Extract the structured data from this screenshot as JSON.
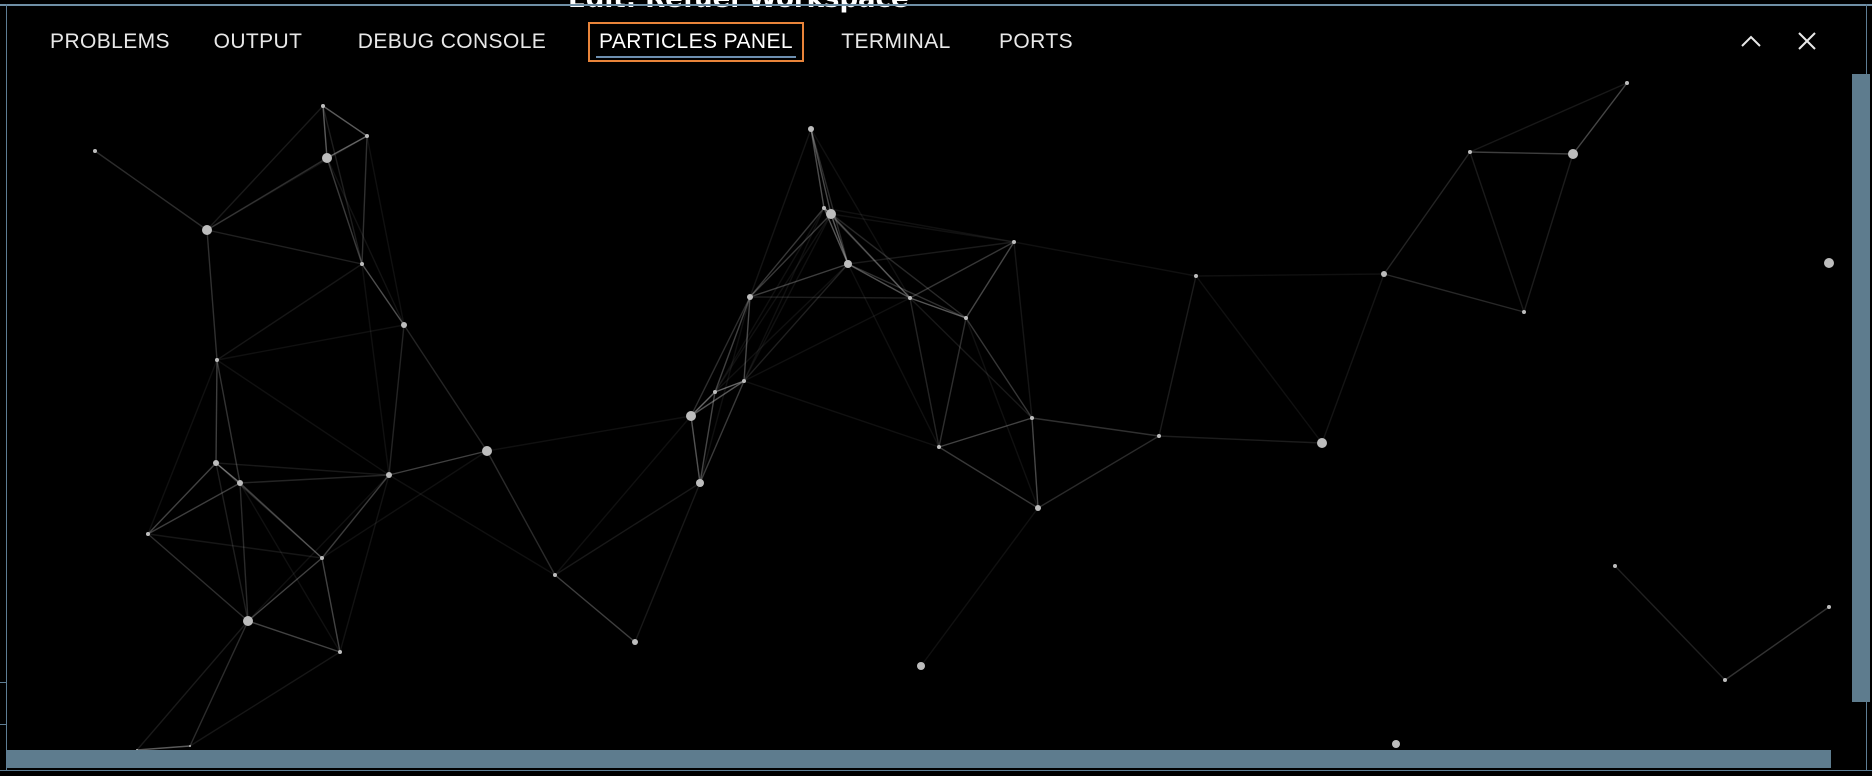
{
  "window": {
    "peek_title": "Edit: Refuel Workspace"
  },
  "tabs": [
    {
      "label": "PROBLEMS",
      "active": false
    },
    {
      "label": "OUTPUT",
      "active": false
    },
    {
      "label": "DEBUG CONSOLE",
      "active": false
    },
    {
      "label": "PARTICLES PANEL",
      "active": true
    },
    {
      "label": "TERMINAL",
      "active": false
    },
    {
      "label": "PORTS",
      "active": false
    }
  ],
  "actions": {
    "maximize_icon": "chevron-up-icon",
    "close_icon": "close-icon"
  },
  "colors": {
    "accent": "#e8843a",
    "underline": "#6d8fb0",
    "scrollbar": "#5e7c8e",
    "particle": "#bdbdbd"
  }
}
